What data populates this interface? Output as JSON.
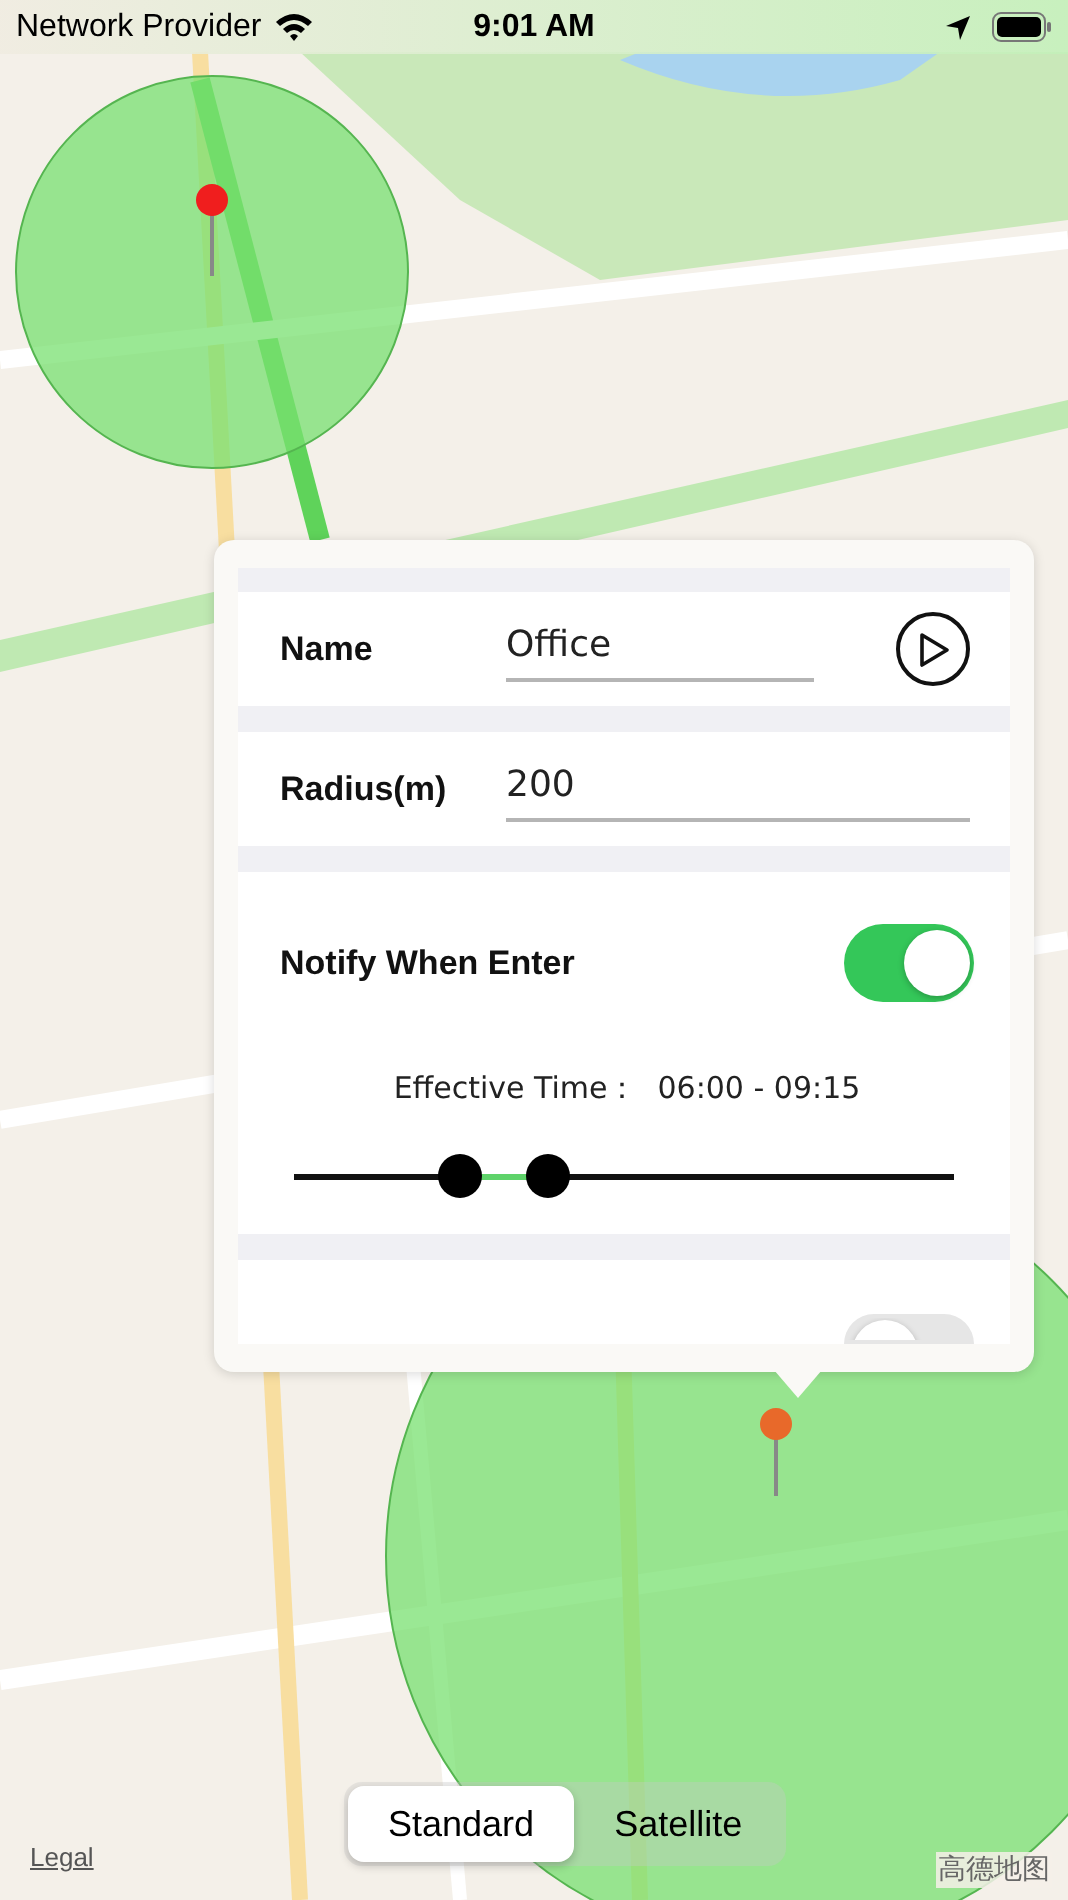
{
  "status_bar": {
    "carrier": "Network Provider",
    "time": "9:01 AM"
  },
  "map": {
    "legal": "Legal",
    "provider_logo": "高德地图"
  },
  "geofence_card": {
    "name": {
      "label": "Name",
      "value": "Office"
    },
    "radius": {
      "label": "Radius(m)",
      "value": "200"
    },
    "notify_enter": {
      "label": "Notify When Enter",
      "on": true
    },
    "effective_time": {
      "label": "Effective Time：",
      "value": "06:00 - 09:15"
    },
    "time_slider": [
      {
        "level": 0.25
      },
      {
        "level": 0.385
      }
    ],
    "notify_exit": {
      "on": false
    }
  },
  "map_type": [
    {
      "label": "Standard",
      "selected": true
    },
    {
      "label": "Satellite",
      "selected": false
    }
  ]
}
